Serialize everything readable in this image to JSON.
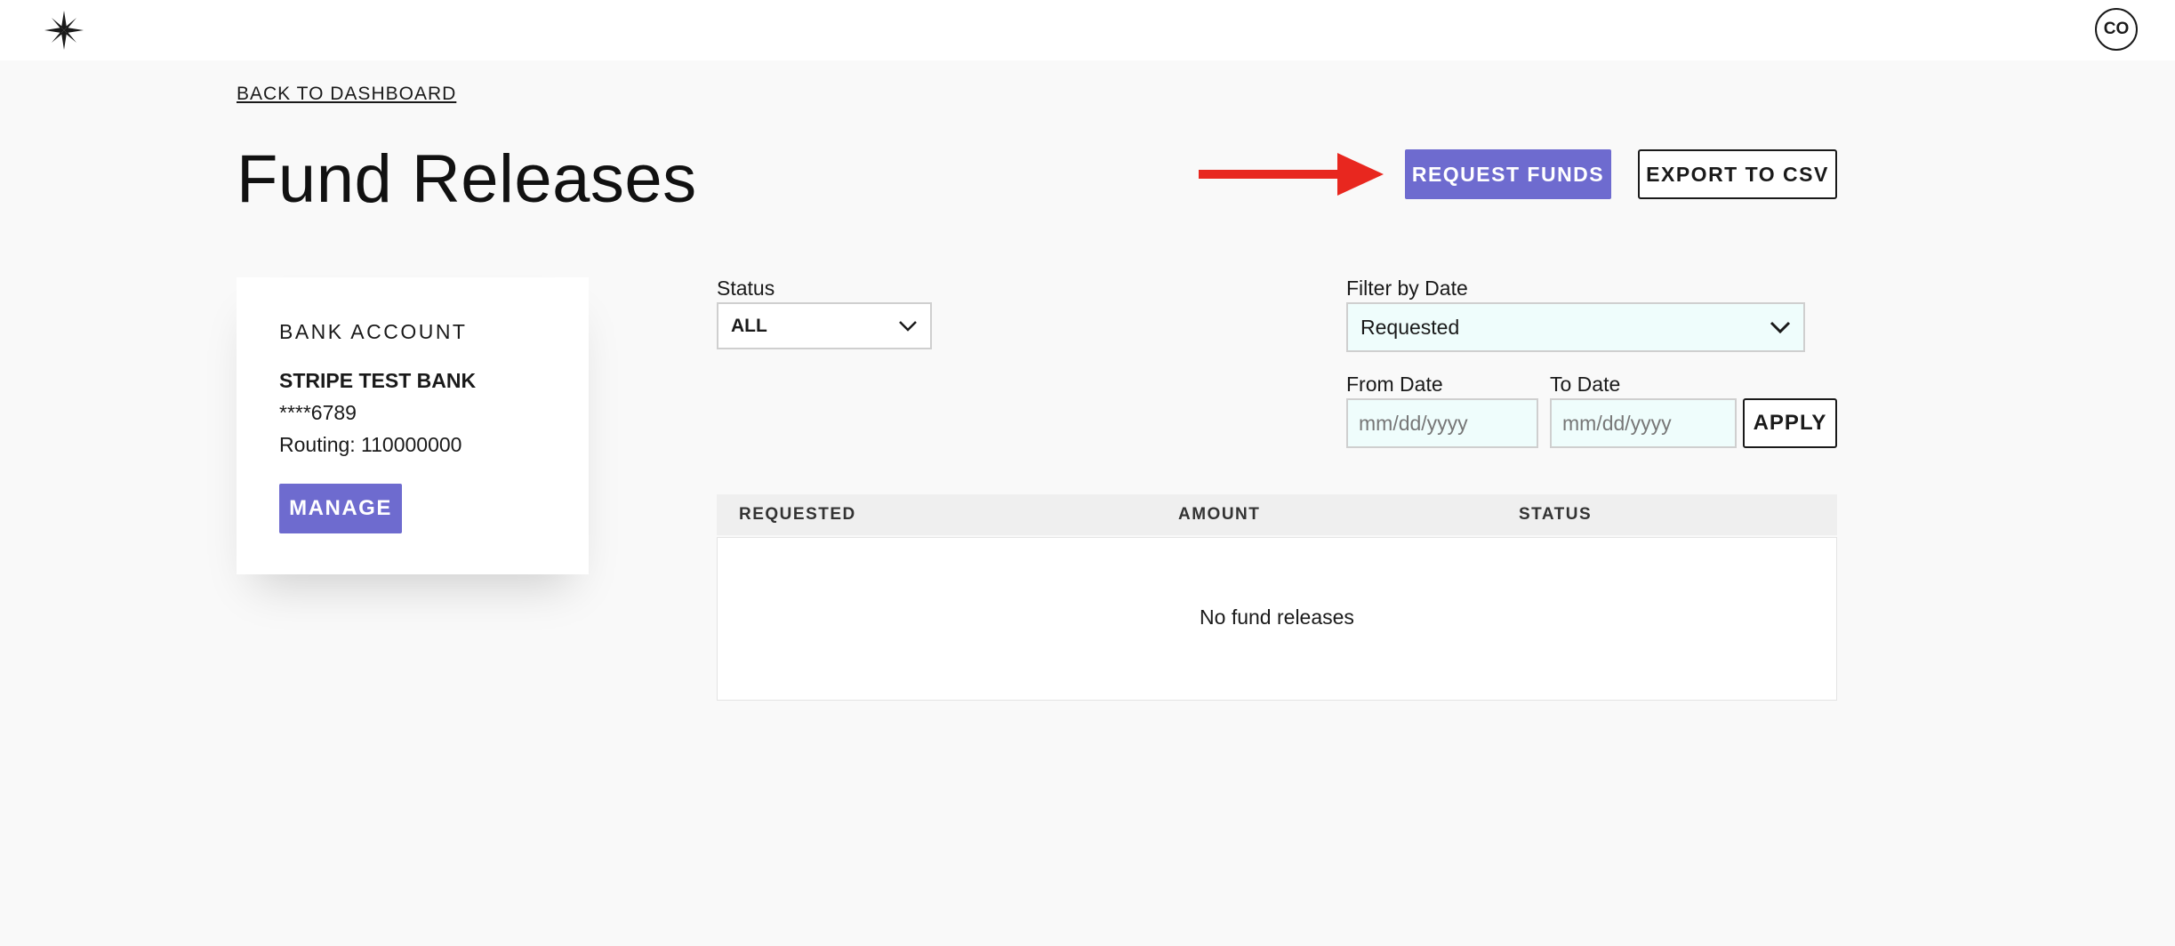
{
  "header": {
    "logo_icon": "compass-star-icon",
    "avatar_initials": "CO"
  },
  "nav": {
    "back_label": "BACK TO DASHBOARD"
  },
  "page": {
    "title": "Fund Releases"
  },
  "annotation": {
    "arrow_icon": "red-arrow-right-icon",
    "arrow_color": "#e8271f"
  },
  "actions": {
    "request_funds_label": "REQUEST FUNDS",
    "export_label": "EXPORT TO CSV",
    "accent_color": "#6e6bcf"
  },
  "bank_account": {
    "heading": "BANK ACCOUNT",
    "bank_name": "STRIPE TEST BANK",
    "masked_number": "****6789",
    "routing": "Routing: 110000000",
    "manage_label": "MANAGE"
  },
  "filters": {
    "status_label": "Status",
    "status_value": "ALL",
    "date_filter_label": "Filter by Date",
    "date_filter_value": "Requested",
    "from_label": "From Date",
    "from_placeholder": "mm/dd/yyyy",
    "to_label": "To Date",
    "to_placeholder": "mm/dd/yyyy",
    "apply_label": "APPLY"
  },
  "table": {
    "columns": [
      "REQUESTED",
      "AMOUNT",
      "STATUS"
    ],
    "empty_message": "No fund releases"
  }
}
